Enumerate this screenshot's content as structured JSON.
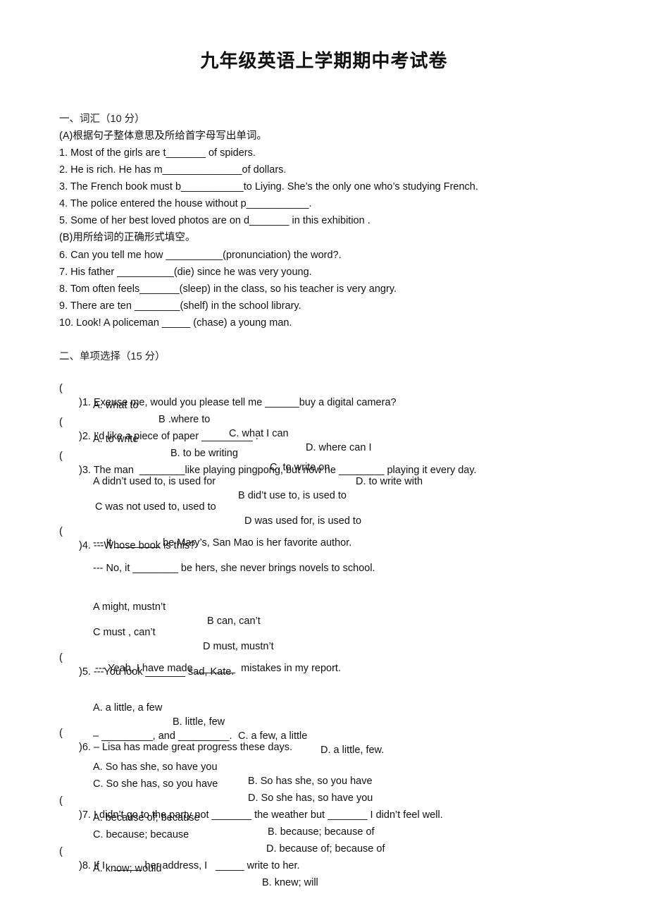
{
  "title": "九年级英语上学期期中考试卷",
  "section1": {
    "heading": "一、词汇（10 分）",
    "partA": "(A)根据句子整体意思及所给首字母写出单词。",
    "items": [
      "1. Most of the girls are t_______ of spiders.",
      "2. He is rich. He has m______________of dollars.",
      "3. The French book must b___________to Liying. She’s the only one who’s studying French.",
      "4. The police entered the house without p___________.",
      "5. Some of her best loved photos are on d_______ in this exhibition ."
    ],
    "partB": "(B)用所给词的正确形式填空。",
    "items_b": [
      "6. Can you tell me how __________(pronunciation) the word?.",
      "7. His father __________(die) since he was very young.",
      "8. Tom often feels_______(sleep) in the class, so his teacher is very angry.",
      "9. There are ten ________(shelf) in the school library.",
      "10. Look! A policeman _____ (chase) a young man."
    ]
  },
  "section2": {
    "heading": "二、单项选择（15 分）",
    "paren": "(",
    "questions": [
      {
        "stem": ")1. Exeuse me, would you please tell me ______buy a digital camera?",
        "options": [
          "A. what to",
          "B .where to",
          "C. what I can",
          "D. where can I"
        ]
      },
      {
        "stem": ")2. I’d like a piece of paper _________ .",
        "options": [
          "A. to write",
          "B. to be writing",
          "C. to write on",
          "D. to write with"
        ]
      },
      {
        "stem": ")3. The man  ________like playing pingpong, but now he ________ playing it every day.",
        "options": [
          "A didn’t used to, is used for",
          "B did’t use to, is used to",
          "C was not used to, used to",
          "D was used for, is used to"
        ]
      },
      {
        "stem": ")4. ---Whose book is this?",
        "lines": [
          "--- It ________ be Mary’s, San Mao is her favorite author.",
          "--- No, it ________ be hers, she never brings novels to school."
        ],
        "options": [
          "A might, mustn’t",
          "B can, can’t",
          "C must , can’t",
          "D must, mustn’t"
        ]
      },
      {
        "stem": ")5. ---You look _______ sad, Kate.",
        "lines": [
          "--- Yeah, I have made _______  mistakes in my report."
        ],
        "options": [
          "A. a little, a few",
          "B. little, few",
          "C. a few, a little",
          "D. a little, few."
        ]
      },
      {
        "stem": ")6. – Lisa has made great progress these days.",
        "lines": [
          "– _________, and _________."
        ],
        "options": [
          "A. So has she, so have you",
          "B. So has she, so you have",
          "C. So she has, so you have",
          "D. So she has, so have you"
        ]
      },
      {
        "stem": ")7. I didn’t go to the party not _______ the weather but _______ I didn’t feel well.",
        "options": [
          "A. because of; because",
          "B. because; because of",
          "C. because; because",
          "D. because of; because of"
        ]
      },
      {
        "stem": ")8. If I   _____ her address, I   _____ write to her.",
        "options": [
          "A. know; would",
          "B. knew; will"
        ]
      }
    ]
  }
}
